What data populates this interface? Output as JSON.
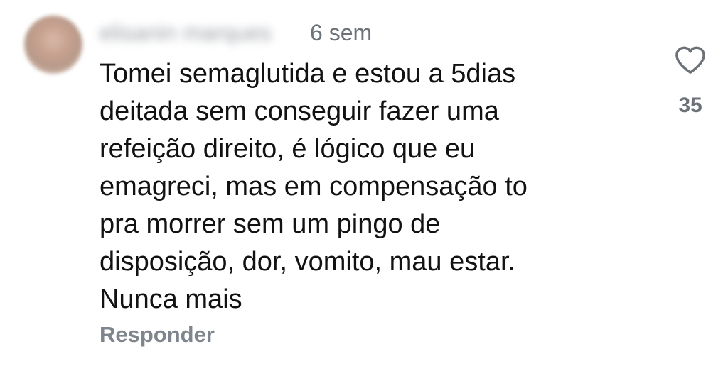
{
  "comment": {
    "username": "elisanin marques",
    "time": "6 sem",
    "text": "Tomei semaglutida e estou a 5dias\ndeitada sem conseguir fazer uma\nrefeição direito, é lógico que eu\nemagreci, mas em compensação to\npra morrer sem um pingo de\ndisposição, dor, vomito, mau estar.\nNunca mais",
    "reply_label": "Responder",
    "like_count": "35",
    "like_icon": "heart-outline-icon"
  },
  "colors": {
    "text": "#121212",
    "secondary": "#6e7378",
    "reply": "#7f858c",
    "icon": "#6c7177"
  }
}
